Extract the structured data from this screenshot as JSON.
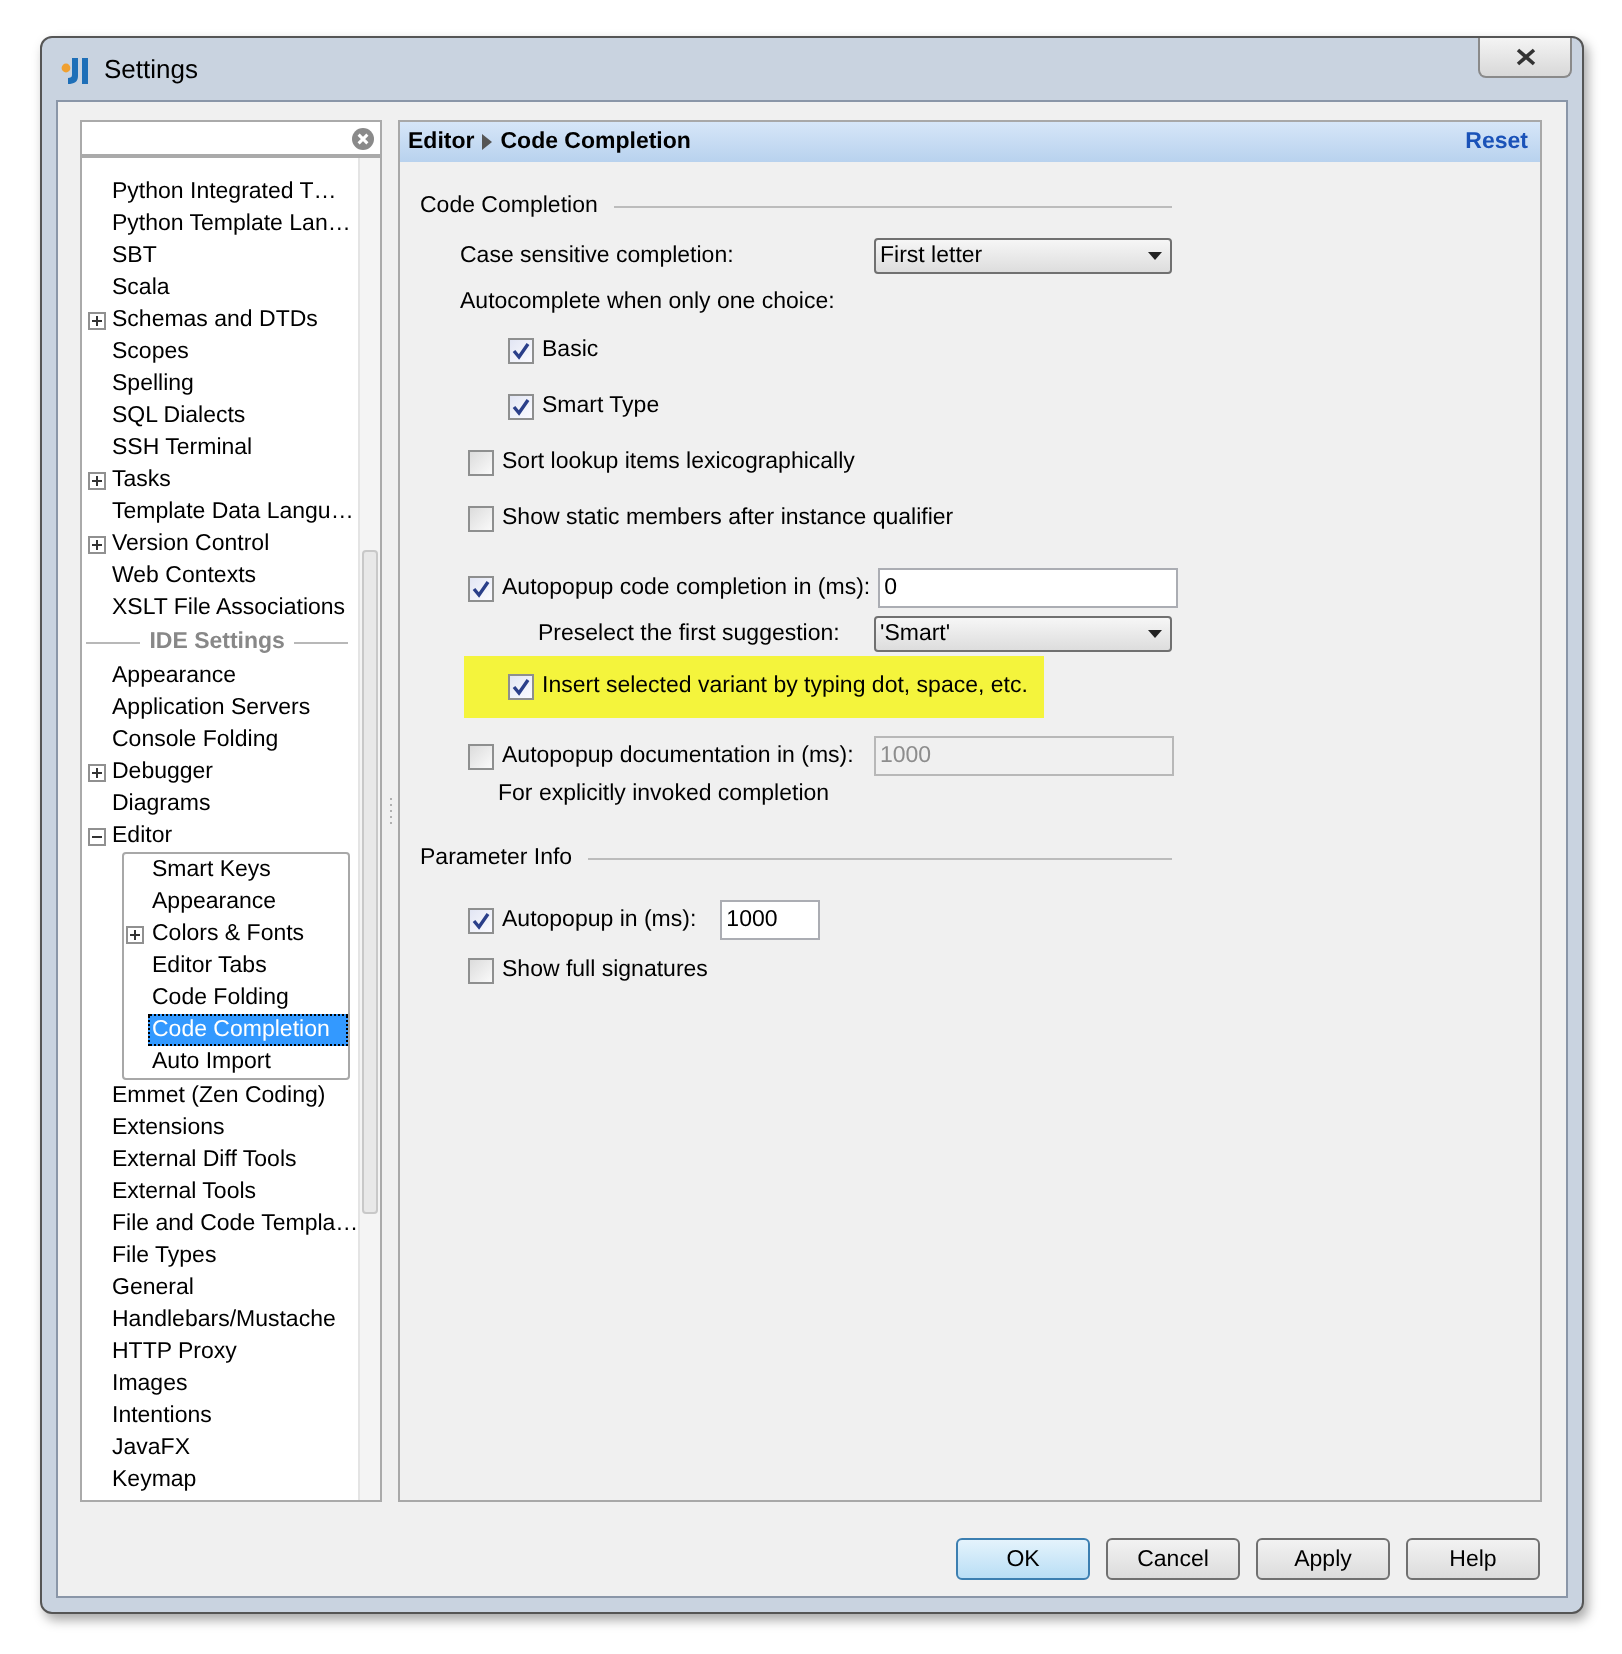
{
  "window": {
    "title": "Settings"
  },
  "sidebar": {
    "items": [
      {
        "kind": "item",
        "label": "Python Integrated T…",
        "selected": false
      },
      {
        "kind": "item",
        "label": "Python Template Lan…",
        "selected": false
      },
      {
        "kind": "item",
        "label": "SBT",
        "selected": false
      },
      {
        "kind": "item",
        "label": "Scala",
        "selected": false
      },
      {
        "kind": "item",
        "label": "Schemas and DTDs",
        "selected": false,
        "expanded": false
      },
      {
        "kind": "item",
        "label": "Scopes",
        "selected": false
      },
      {
        "kind": "item",
        "label": "Spelling",
        "selected": false
      },
      {
        "kind": "item",
        "label": "SQL Dialects",
        "selected": false
      },
      {
        "kind": "item",
        "label": "SSH Terminal",
        "selected": false
      },
      {
        "kind": "item",
        "label": "Tasks",
        "selected": false,
        "expanded": false
      },
      {
        "kind": "item",
        "label": "Template Data Langu…",
        "selected": false
      },
      {
        "kind": "item",
        "label": "Version Control",
        "selected": false,
        "expanded": false
      },
      {
        "kind": "item",
        "label": "Web Contexts",
        "selected": false
      },
      {
        "kind": "item",
        "label": "XSLT File Associations",
        "selected": false
      },
      {
        "kind": "header",
        "label": "IDE Settings"
      },
      {
        "kind": "item",
        "label": "Appearance",
        "selected": false
      },
      {
        "kind": "item",
        "label": "Application Servers",
        "selected": false
      },
      {
        "kind": "item",
        "label": "Console Folding",
        "selected": false
      },
      {
        "kind": "item",
        "label": "Debugger",
        "selected": false,
        "expanded": false
      },
      {
        "kind": "item",
        "label": "Diagrams",
        "selected": false
      },
      {
        "kind": "item",
        "label": "Editor",
        "selected": false,
        "expanded": true,
        "children": [
          {
            "label": "Smart Keys",
            "selected": false
          },
          {
            "label": "Appearance",
            "selected": false
          },
          {
            "label": "Colors & Fonts",
            "selected": false,
            "expanded": false
          },
          {
            "label": "Editor Tabs",
            "selected": false
          },
          {
            "label": "Code Folding",
            "selected": false
          },
          {
            "label": "Code Completion",
            "selected": true
          },
          {
            "label": "Auto Import",
            "selected": false
          }
        ]
      },
      {
        "kind": "item",
        "label": "Emmet (Zen Coding)",
        "selected": false
      },
      {
        "kind": "item",
        "label": "Extensions",
        "selected": false
      },
      {
        "kind": "item",
        "label": "External Diff Tools",
        "selected": false
      },
      {
        "kind": "item",
        "label": "External Tools",
        "selected": false
      },
      {
        "kind": "item",
        "label": "File and Code Templa…",
        "selected": false
      },
      {
        "kind": "item",
        "label": "File Types",
        "selected": false
      },
      {
        "kind": "item",
        "label": "General",
        "selected": false
      },
      {
        "kind": "item",
        "label": "Handlebars/Mustache",
        "selected": false
      },
      {
        "kind": "item",
        "label": "HTTP Proxy",
        "selected": false
      },
      {
        "kind": "item",
        "label": "Images",
        "selected": false
      },
      {
        "kind": "item",
        "label": "Intentions",
        "selected": false
      },
      {
        "kind": "item",
        "label": "JavaFX",
        "selected": false
      },
      {
        "kind": "item",
        "label": "Keymap",
        "selected": false
      }
    ]
  },
  "panel": {
    "breadcrumb": [
      "Editor",
      "Code Completion"
    ],
    "reset": "Reset",
    "sections": [
      {
        "title": "Code Completion",
        "rows": [
          {
            "kind": "dropdown",
            "label": "Case sensitive completion:",
            "value": "First letter"
          },
          {
            "kind": "label",
            "label": "Autocomplete when only one choice:",
            "children": [
              {
                "kind": "checkbox",
                "label": "Basic",
                "checked": true
              },
              {
                "kind": "checkbox",
                "label": "Smart Type",
                "checked": true
              }
            ]
          },
          {
            "kind": "checkbox",
            "label": "Sort lookup items lexicographically",
            "checked": false
          },
          {
            "kind": "checkbox",
            "label": "Show static members after instance qualifier",
            "checked": false
          },
          {
            "kind": "checkbox_field",
            "label": "Autopopup code completion in (ms):",
            "checked": true,
            "value": "0",
            "field_disabled": false,
            "children": [
              {
                "kind": "dropdown",
                "label": "Preselect the first suggestion:",
                "value": "'Smart'"
              },
              {
                "kind": "checkbox",
                "label": "Insert selected variant by typing dot, space, etc.",
                "checked": true,
                "highlighted": true
              }
            ]
          },
          {
            "kind": "checkbox_field",
            "label": "Autopopup documentation in (ms):",
            "checked": false,
            "value": "1000",
            "field_disabled": true,
            "children": [
              {
                "kind": "note",
                "label": "For explicitly invoked completion"
              }
            ]
          }
        ]
      },
      {
        "title": "Parameter Info",
        "rows": [
          {
            "kind": "checkbox_field",
            "label": "Autopopup in (ms):",
            "checked": true,
            "value": "1000",
            "field_disabled": false
          },
          {
            "kind": "checkbox",
            "label": "Show full signatures",
            "checked": false
          }
        ]
      }
    ]
  },
  "buttons": [
    {
      "label": "OK",
      "default": true
    },
    {
      "label": "Cancel",
      "default": false
    },
    {
      "label": "Apply",
      "default": false
    },
    {
      "label": "Help",
      "default": false
    }
  ]
}
